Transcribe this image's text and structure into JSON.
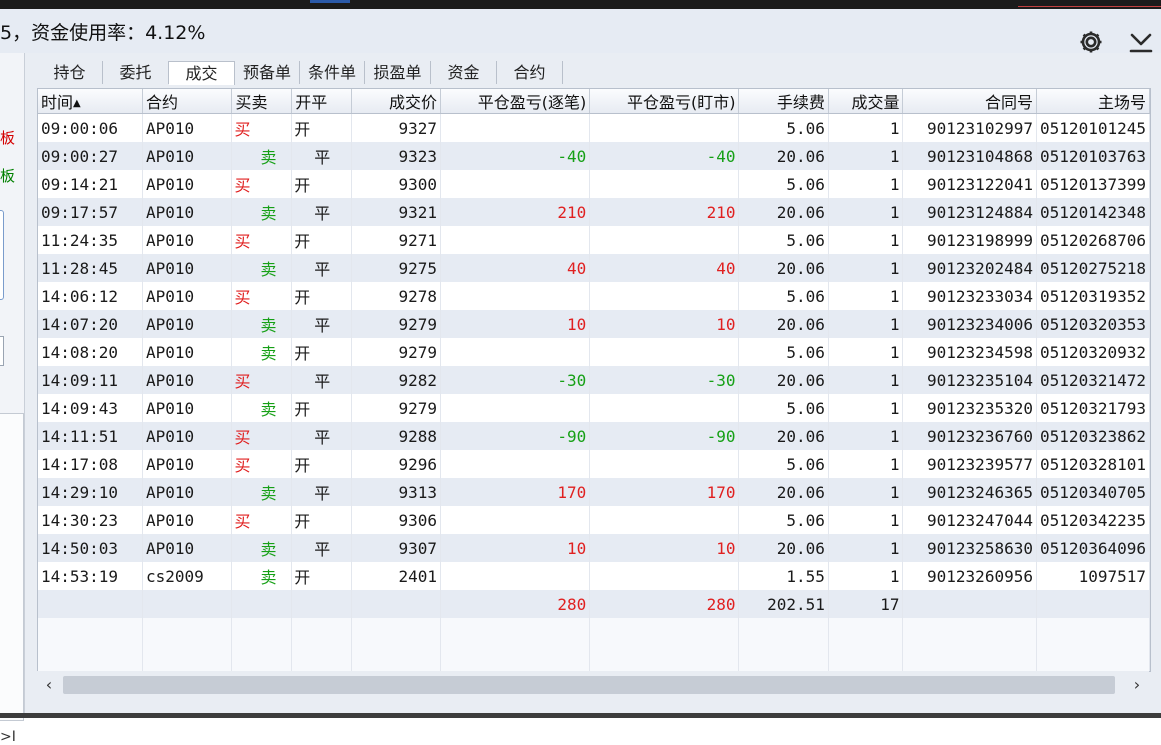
{
  "header": {
    "prefix": "5，资金使用率：",
    "fund_usage": "4.12%",
    "icons": [
      "gear-icon",
      "download-icon"
    ]
  },
  "left_panel": {
    "red_label": "板",
    "green_label": "板",
    "bottom_glyph": ">I"
  },
  "tabs": [
    {
      "label": "持仓"
    },
    {
      "label": "委托"
    },
    {
      "label": "成交",
      "active": true
    },
    {
      "label": "预备单"
    },
    {
      "label": "条件单"
    },
    {
      "label": "损盈单"
    },
    {
      "label": "资金"
    },
    {
      "label": "合约"
    }
  ],
  "columns": [
    "时间",
    "合约",
    "买卖",
    "开平",
    "成交价",
    "平仓盈亏(逐笔)",
    "平仓盈亏(盯市)",
    "手续费",
    "成交量",
    "合同号",
    "主场号"
  ],
  "sort_indicator": "▲",
  "rows": [
    {
      "time": "09:00:06",
      "contract": "AP010",
      "side": "买",
      "oc": "开",
      "price": "9327",
      "pnl_trade": "",
      "pnl_mtm": "",
      "fee": "5.06",
      "qty": "1",
      "contract_no": "90123102997",
      "main_no": "05120101245"
    },
    {
      "time": "09:00:27",
      "contract": "AP010",
      "side": "卖",
      "oc": "平",
      "price": "9323",
      "pnl_trade": "-40",
      "pnl_mtm": "-40",
      "fee": "20.06",
      "qty": "1",
      "contract_no": "90123104868",
      "main_no": "05120103763"
    },
    {
      "time": "09:14:21",
      "contract": "AP010",
      "side": "买",
      "oc": "开",
      "price": "9300",
      "pnl_trade": "",
      "pnl_mtm": "",
      "fee": "5.06",
      "qty": "1",
      "contract_no": "90123122041",
      "main_no": "05120137399"
    },
    {
      "time": "09:17:57",
      "contract": "AP010",
      "side": "卖",
      "oc": "平",
      "price": "9321",
      "pnl_trade": "210",
      "pnl_mtm": "210",
      "fee": "20.06",
      "qty": "1",
      "contract_no": "90123124884",
      "main_no": "05120142348"
    },
    {
      "time": "11:24:35",
      "contract": "AP010",
      "side": "买",
      "oc": "开",
      "price": "9271",
      "pnl_trade": "",
      "pnl_mtm": "",
      "fee": "5.06",
      "qty": "1",
      "contract_no": "90123198999",
      "main_no": "05120268706"
    },
    {
      "time": "11:28:45",
      "contract": "AP010",
      "side": "卖",
      "oc": "平",
      "price": "9275",
      "pnl_trade": "40",
      "pnl_mtm": "40",
      "fee": "20.06",
      "qty": "1",
      "contract_no": "90123202484",
      "main_no": "05120275218"
    },
    {
      "time": "14:06:12",
      "contract": "AP010",
      "side": "买",
      "oc": "开",
      "price": "9278",
      "pnl_trade": "",
      "pnl_mtm": "",
      "fee": "5.06",
      "qty": "1",
      "contract_no": "90123233034",
      "main_no": "05120319352"
    },
    {
      "time": "14:07:20",
      "contract": "AP010",
      "side": "卖",
      "oc": "平",
      "price": "9279",
      "pnl_trade": "10",
      "pnl_mtm": "10",
      "fee": "20.06",
      "qty": "1",
      "contract_no": "90123234006",
      "main_no": "05120320353"
    },
    {
      "time": "14:08:20",
      "contract": "AP010",
      "side": "卖",
      "oc": "开",
      "price": "9279",
      "pnl_trade": "",
      "pnl_mtm": "",
      "fee": "5.06",
      "qty": "1",
      "contract_no": "90123234598",
      "main_no": "05120320932"
    },
    {
      "time": "14:09:11",
      "contract": "AP010",
      "side": "买",
      "oc": "平",
      "price": "9282",
      "pnl_trade": "-30",
      "pnl_mtm": "-30",
      "fee": "20.06",
      "qty": "1",
      "contract_no": "90123235104",
      "main_no": "05120321472"
    },
    {
      "time": "14:09:43",
      "contract": "AP010",
      "side": "卖",
      "oc": "开",
      "price": "9279",
      "pnl_trade": "",
      "pnl_mtm": "",
      "fee": "5.06",
      "qty": "1",
      "contract_no": "90123235320",
      "main_no": "05120321793"
    },
    {
      "time": "14:11:51",
      "contract": "AP010",
      "side": "买",
      "oc": "平",
      "price": "9288",
      "pnl_trade": "-90",
      "pnl_mtm": "-90",
      "fee": "20.06",
      "qty": "1",
      "contract_no": "90123236760",
      "main_no": "05120323862"
    },
    {
      "time": "14:17:08",
      "contract": "AP010",
      "side": "买",
      "oc": "开",
      "price": "9296",
      "pnl_trade": "",
      "pnl_mtm": "",
      "fee": "5.06",
      "qty": "1",
      "contract_no": "90123239577",
      "main_no": "05120328101"
    },
    {
      "time": "14:29:10",
      "contract": "AP010",
      "side": "卖",
      "oc": "平",
      "price": "9313",
      "pnl_trade": "170",
      "pnl_mtm": "170",
      "fee": "20.06",
      "qty": "1",
      "contract_no": "90123246365",
      "main_no": "05120340705"
    },
    {
      "time": "14:30:23",
      "contract": "AP010",
      "side": "买",
      "oc": "开",
      "price": "9306",
      "pnl_trade": "",
      "pnl_mtm": "",
      "fee": "5.06",
      "qty": "1",
      "contract_no": "90123247044",
      "main_no": "05120342235"
    },
    {
      "time": "14:50:03",
      "contract": "AP010",
      "side": "卖",
      "oc": "平",
      "price": "9307",
      "pnl_trade": "10",
      "pnl_mtm": "10",
      "fee": "20.06",
      "qty": "1",
      "contract_no": "90123258630",
      "main_no": "05120364096"
    },
    {
      "time": "14:53:19",
      "contract": "cs2009",
      "side": "卖",
      "oc": "开",
      "price": "2401",
      "pnl_trade": "",
      "pnl_mtm": "",
      "fee": "1.55",
      "qty": "1",
      "contract_no": "90123260956",
      "main_no": "1097517"
    }
  ],
  "totals": {
    "pnl_trade": "280",
    "pnl_mtm": "280",
    "fee": "202.51",
    "qty": "17"
  },
  "colors": {
    "buy": "#e02020",
    "sell": "#16a016",
    "row_alt": "#e6ebf3",
    "header_bg": "#e6ebf3"
  }
}
